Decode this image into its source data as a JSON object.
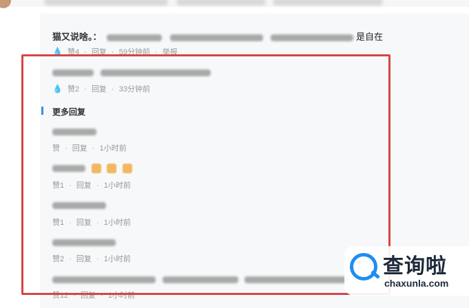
{
  "comments": [
    {
      "author": "猫又说啥。：",
      "text_tail": "是自在",
      "meta": {
        "likes": "赞4",
        "reply": "回复",
        "time": "59分钟前",
        "report": "举报"
      }
    },
    {
      "meta": {
        "likes": "赞2",
        "reply": "回复",
        "time": "33分钟前"
      }
    }
  ],
  "more_replies": {
    "title": "更多回复",
    "items": [
      {
        "meta": {
          "likes": "赞",
          "reply": "回复",
          "time": "1小时前"
        }
      },
      {
        "meta": {
          "likes": "赞1",
          "reply": "回复",
          "time": "1小时前"
        }
      },
      {
        "meta": {
          "likes": "赞1",
          "reply": "回复",
          "time": "1小时前"
        }
      },
      {
        "meta": {
          "likes": "赞2",
          "reply": "回复",
          "time": "1小时前"
        }
      },
      {
        "meta": {
          "likes": "赞12",
          "reply": "回复",
          "time": "1小时前"
        }
      }
    ]
  },
  "watermark": {
    "title": "查询啦",
    "domain": "chaxunla.com"
  },
  "colors": {
    "highlight_box": "#d64545",
    "accent": "#3b8ee0",
    "meta_text": "#999999"
  },
  "icons": [
    "water-drop-icon",
    "thumbs-up-icon",
    "search-logo-icon"
  ]
}
